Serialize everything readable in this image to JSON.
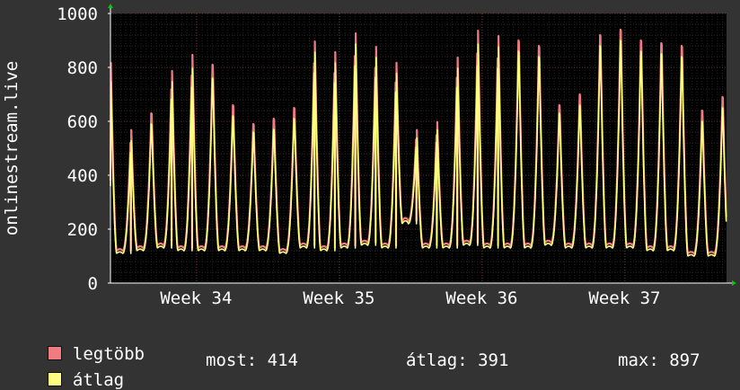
{
  "chart_data": {
    "type": "line",
    "ylabel": "onlinestream.live",
    "ylim": [
      0,
      1000
    ],
    "yticks": [
      0,
      200,
      400,
      600,
      800,
      1000
    ],
    "xticks": [
      "Week 34",
      "Week 35",
      "Week 36",
      "Week 37"
    ],
    "x_unit": "day",
    "x_range_days": [
      0,
      30.2
    ],
    "week_tick_days": [
      4.2,
      11.2,
      18.2,
      25.2
    ],
    "grid": true,
    "legend_placement": "bottom-left",
    "series": [
      {
        "name": "legtöbb",
        "color": "#f07c82",
        "daily_peaks": [
          820,
          570,
          630,
          790,
          850,
          810,
          660,
          590,
          610,
          650,
          900,
          860,
          930,
          880,
          820,
          570,
          600,
          840,
          940,
          920,
          900,
          880,
          660,
          700,
          920,
          940,
          900,
          890,
          880,
          640,
          690
        ],
        "daily_lows": [
          380,
          120,
          130,
          140,
          130,
          130,
          130,
          130,
          130,
          120,
          140,
          130,
          140,
          150,
          140,
          230,
          140,
          140,
          150,
          140,
          140,
          140,
          150,
          140,
          140,
          140,
          140,
          130,
          130,
          110,
          110
        ]
      },
      {
        "name": "átlag",
        "color": "#ffff80",
        "daily_peaks": [
          750,
          530,
          590,
          750,
          800,
          760,
          620,
          560,
          570,
          610,
          860,
          820,
          890,
          840,
          780,
          540,
          570,
          800,
          890,
          880,
          860,
          840,
          630,
          660,
          880,
          900,
          860,
          850,
          840,
          600,
          650
        ],
        "daily_lows": [
          360,
          110,
          120,
          130,
          120,
          120,
          120,
          120,
          120,
          110,
          130,
          120,
          130,
          140,
          130,
          220,
          130,
          130,
          140,
          130,
          130,
          130,
          140,
          130,
          130,
          130,
          130,
          120,
          120,
          100,
          100
        ]
      }
    ]
  },
  "legend": {
    "items": [
      {
        "label": "legtöbb",
        "color": "#f07c82"
      },
      {
        "label": "átlag",
        "color": "#ffff80"
      }
    ]
  },
  "stats": {
    "most": "most: 414",
    "atlag": "átlag: 391",
    "max": "max: 897"
  },
  "colors": {
    "background": "#333333",
    "plot_background": "#000000",
    "grid": "#3a3a3a",
    "axis": "#ffffff",
    "arrow": "#00cc00"
  }
}
